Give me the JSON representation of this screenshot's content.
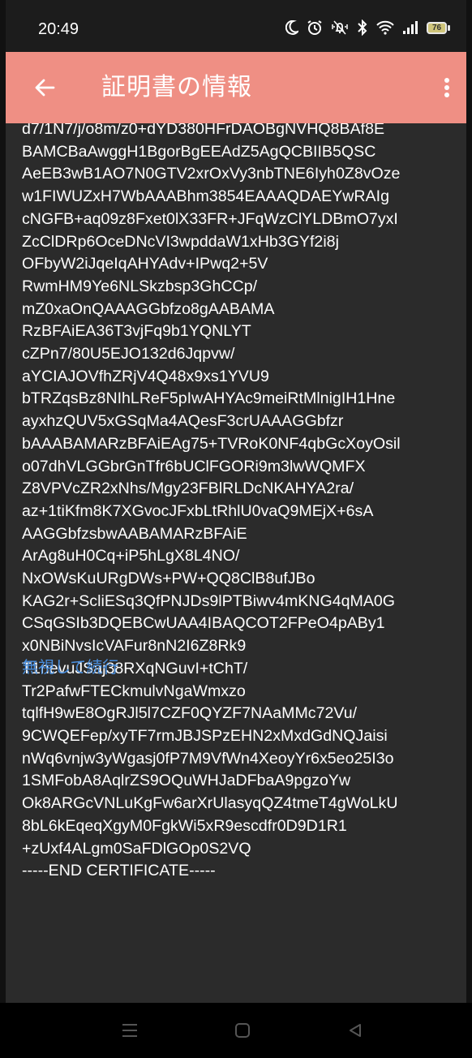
{
  "status_bar": {
    "time": "20:49",
    "battery": "76",
    "icons": [
      "moon-icon",
      "alarm-icon",
      "vibrate-icon",
      "bluetooth-icon",
      "wifi-icon",
      "signal-icon",
      "battery-icon"
    ]
  },
  "app_bar": {
    "title": "証明書の情報",
    "back_icon": "arrow-left-icon",
    "menu_icon": "more-vert-icon",
    "color": "#ef8f84"
  },
  "certificate": {
    "lines": [
      "d7/1N7/j/o8m/z0+dYD380HFrDAOBgNVHQ8BAf8E",
      "BAMCBaAwggH1BgorBgEEAdZ5AgQCBIIB5QSC",
      "AeEB3wB1AO7N0GTV2xrOxVy3nbTNE6Iyh0Z8vOze",
      "w1FIWUZxH7WbAAABhm3854EAAAQDAEYwRAIg",
      "cNGFB+aq09z8Fxet0lX33FR+JFqWzClYLDBmO7yxI",
      "ZcClDRp6OceDNcVI3wpddaW1xHb3GYf2i8j",
      "OFbyW2iJqeIqAHYAdv+IPwq2+5V",
      "RwmHM9Ye6NLSkzbsp3GhCCp/",
      "mZ0xaOnQAAAGGbfzo8gAABAMA",
      "RzBFAiEA36T3vjFq9b1YQNLYT",
      "cZPn7/80U5EJO132d6Jqpvw/",
      "aYCIAJOVfhZRjV4Q48x9xs1YVU9",
      "bTRZqsBz8NIhLReF5pIwAHYAc9meiRtMlnigIH1Hne",
      "ayxhzQUV5xGSqMa4AQesF3crUAAAGGbfzr",
      "bAAABAMARzBFAiEAg75+TVRoK0NF4qbGcXoyOsil",
      "o07dhVLGGbrGnTfr6bUClFGORi9m3lwWQMFX",
      "Z8VPVcZR2xNhs/Mgy23FBlRLDcNKAHYA2ra/",
      "az+1tiKfm8K7XGvocJFxbLtRhlU0vaQ9MEjX+6sA",
      "AAGGbfzsbwAABAMARzBFAiE",
      "ArAg8uH0Cq+iP5hLgX8L4NO/",
      "NxOWsKuURgDWs+PW+QQ8ClB8ufJBo",
      "KAG2r+ScliESq3QfPNJDs9lPTBiwv4mKNG4qMA0G",
      "CSqGSIb3DQEBCwUAA4IBAQCOT2FPeO4pABy1",
      "x0NBiNvsIcVAFur8nN2I6Z8Rk9",
      "T1nevuJSaj38RXqNGuvI+tChT/",
      "Tr2PafwFTECkmulvNgaWmxzo",
      "tqlfH9wE8OgRJl5l7CZF0QYZF7NAaMMc72Vu/",
      "9CWQEFep/xyTF7rmJBJSPzEHN2xMxdGdNQJaisi",
      "nWq6vnjw3yWgasj0fP7M9VfWn4XeoyYr6x5eo25I3o",
      "1SMFobA8AqlrZS9OQuWHJaDFbaA9pgzoYw",
      "Ok8ARGcVNLuKgFw6arXrUlasyqQZ4tmeT4gWoLkU",
      "8bL6kEqeqXgyM0FgkWi5xR9escdfr0D9D1R1",
      "+zUxf4ALgm0SaFDlGOp0S2VQ",
      "-----END CERTIFICATE-----"
    ]
  },
  "actions": {
    "ignore_continue": "無視して続行",
    "link_color": "#4a8fdf"
  },
  "nav_bar": {
    "icons": [
      "menu-icon",
      "home-square-icon",
      "back-triangle-icon"
    ]
  }
}
